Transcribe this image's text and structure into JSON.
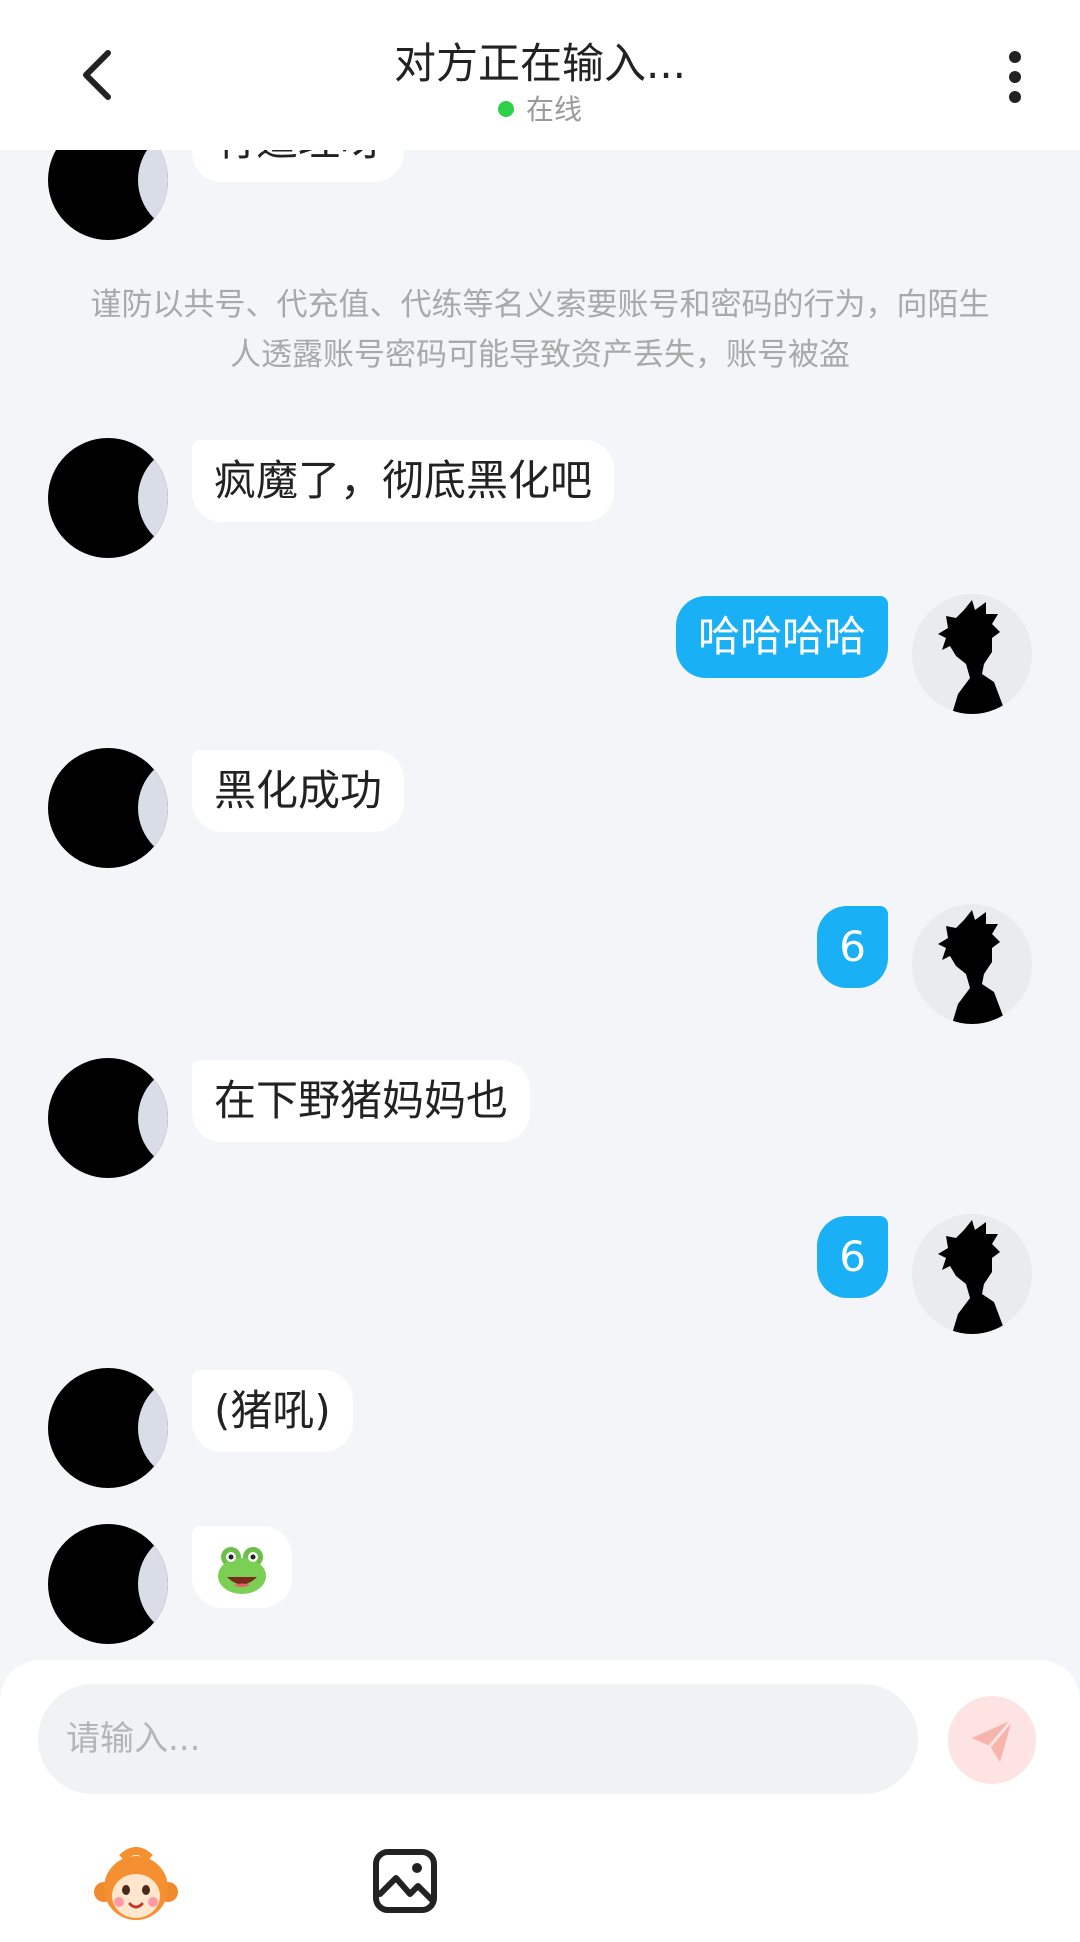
{
  "header": {
    "title": "对方正在输入...",
    "status_text": "在线",
    "status_color": "#2ed047"
  },
  "chat": {
    "partial_top_bubble": "有道理呀",
    "notice": "谨防以共号、代充值、代练等名义索要账号和密码的行为，向陌生人透露账号密码可能导致资产丢失，账号被盗",
    "messages": [
      {
        "side": "left",
        "text": "疯魔了，彻底黑化吧"
      },
      {
        "side": "right",
        "text": "哈哈哈哈"
      },
      {
        "side": "left",
        "text": "黑化成功"
      },
      {
        "side": "right",
        "text": "6"
      },
      {
        "side": "left",
        "text": "在下野猪妈妈也"
      },
      {
        "side": "right",
        "text": "6"
      },
      {
        "side": "left",
        "text": "(猪吼)"
      },
      {
        "side": "left",
        "text": "🐸"
      }
    ],
    "bubble_self_color": "#1ab0f5"
  },
  "input": {
    "placeholder": "请输入..."
  },
  "icons": {
    "back": "chevron-left-icon",
    "more": "more-vertical-icon",
    "send": "paper-plane-icon",
    "emoji": "monkey-emoji-icon",
    "image": "image-icon"
  }
}
